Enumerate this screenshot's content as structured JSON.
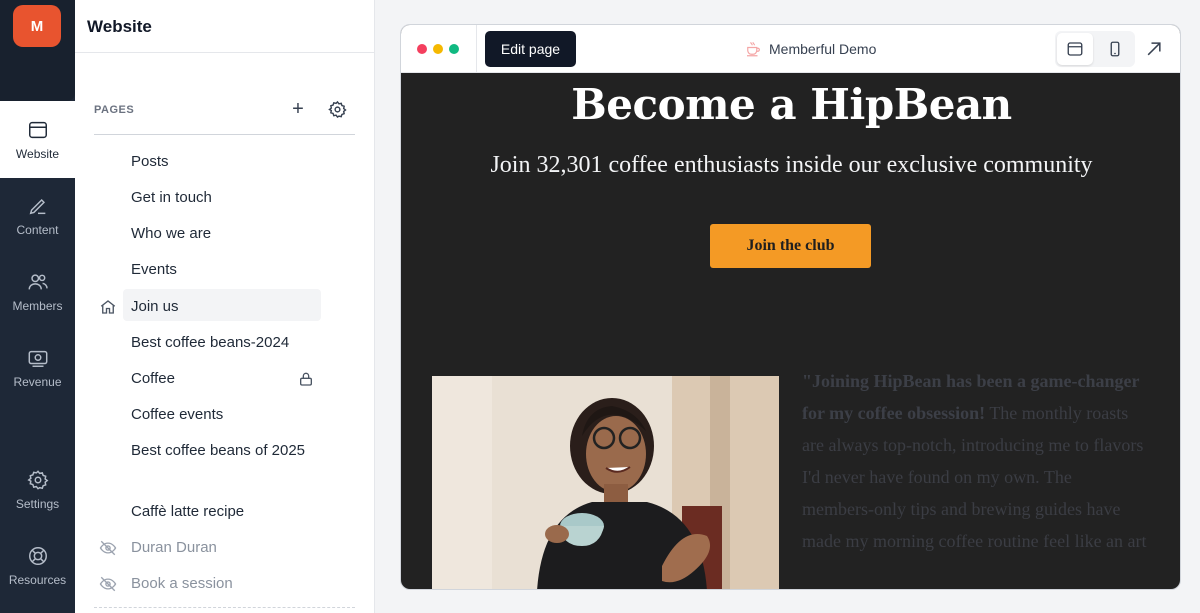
{
  "rail": {
    "logo_letter": "M",
    "items": [
      {
        "label": "Website",
        "icon": "browser-window-icon"
      },
      {
        "label": "Content",
        "icon": "pencil-icon"
      },
      {
        "label": "Members",
        "icon": "users-icon"
      },
      {
        "label": "Revenue",
        "icon": "banknote-icon"
      },
      {
        "label": "Settings",
        "icon": "gear-icon"
      },
      {
        "label": "Resources",
        "icon": "lifebuoy-icon"
      }
    ]
  },
  "sidebar": {
    "title": "Website",
    "pages_label": "PAGES",
    "add_label": "+",
    "pages": [
      {
        "label": "Posts"
      },
      {
        "label": "Get in touch"
      },
      {
        "label": "Who we are"
      },
      {
        "label": "Events"
      },
      {
        "label": "Join us",
        "home": true
      },
      {
        "label": "Best coffee beans-2024"
      },
      {
        "label": "Coffee",
        "locked": true
      },
      {
        "label": "Coffee events"
      },
      {
        "label": "Best coffee beans of 2025"
      },
      {
        "label": "Caffè latte recipe"
      },
      {
        "label": "Duran Duran",
        "hidden": true
      },
      {
        "label": "Book a session",
        "hidden": true
      }
    ]
  },
  "preview": {
    "edit_button": "Edit page",
    "site_name": "Memberful Demo",
    "hero_title": "Become a HipBean",
    "hero_subtitle": "Join 32,301 coffee enthusiasts inside our exclusive community",
    "cta_label": "Join the club",
    "quote_bold": "\"Joining HipBean  has been a game-changer for my coffee obsession!",
    "quote_rest": " The monthly roasts are always top-notch, introducing me to flavors I'd never have found on my own. The members-only tips and brewing guides have made my morning coffee routine feel like an art",
    "colors": {
      "accent": "#f49a25",
      "logo": "#e8542f",
      "hero_bg": "#222222"
    }
  }
}
